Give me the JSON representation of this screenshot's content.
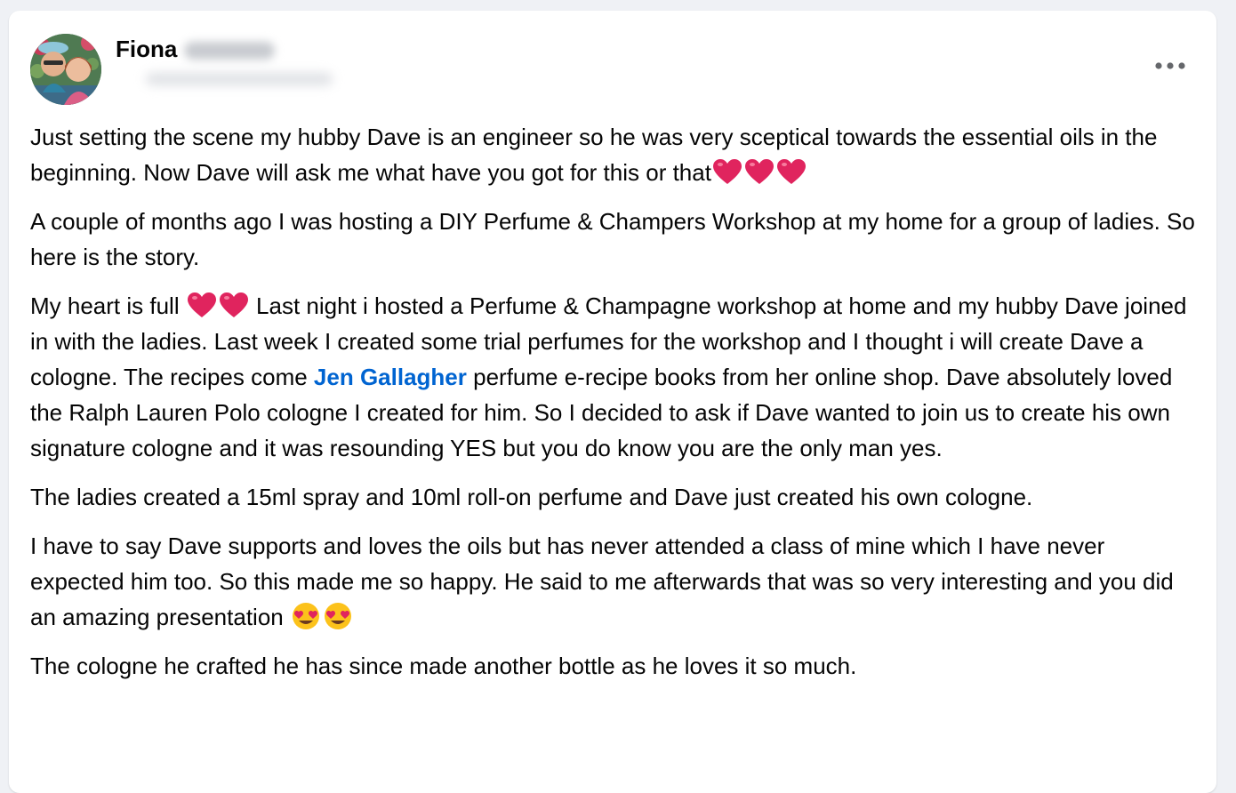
{
  "post": {
    "author_first_name": "Fiona",
    "colors": {
      "background": "#eff1f5",
      "card": "#ffffff",
      "text": "#050505",
      "mention": "#0064d1",
      "heart": "#e0245e"
    },
    "paragraphs": [
      {
        "text": "Just setting the scene my hubby Dave is an engineer so he was very sceptical towards the essential oils in the beginning. Now Dave will ask me what have you got for this or that"
      },
      {
        "text": "A couple of months ago I was hosting a DIY Perfume & Champers Workshop at my home for a group of ladies. So here is the story."
      },
      {
        "before_hearts": "My heart is full ",
        "after_hearts": " Last night i hosted a Perfume & Champagne workshop at home and my hubby Dave joined in with the ladies.  Last week I created some trial perfumes for the workshop and I thought i will create Dave a cologne. The recipes come ",
        "mention": "Jen Gallagher",
        "after_mention": "  perfume e-recipe books from her online shop.   Dave absolutely loved the Ralph Lauren Polo cologne I created for him.  So I decided to ask if Dave wanted to join us to create his own signature cologne and it was resounding YES but you do know you are the only man yes."
      },
      {
        "text": "The ladies created a 15ml spray and 10ml roll-on perfume and Dave just created his own cologne."
      },
      {
        "text": "I have to say Dave supports and loves the oils but has never attended a class of mine which I have never expected him too.  So this made me so happy.  He said to me afterwards that was so very interesting and you did an amazing presentation "
      },
      {
        "text": "The cologne he crafted he has since made another bottle as he loves it so much."
      }
    ],
    "icons": {
      "avatar": "profile-photo",
      "more": "ellipsis-icon",
      "heart": "red-heart-emoji",
      "heart_eyes": "heart-eyes-emoji"
    }
  }
}
